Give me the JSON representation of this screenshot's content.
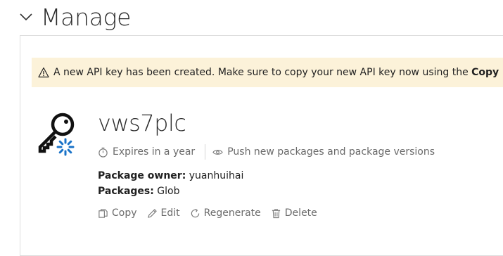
{
  "section": {
    "title": "Manage",
    "chevron_icon": "chevron-down-icon"
  },
  "alert": {
    "icon": "warning-icon",
    "text": "A new API key has been created. Make sure to copy your new API key now using the ",
    "bold_text": "Copy",
    "background": "#fcf2d9"
  },
  "api_key": {
    "icon": "key-icon",
    "name": "vws7plc",
    "expires": "Expires in a year",
    "scope": "Push new packages and package versions",
    "owner_label": "Package owner:",
    "owner_value": "yuanhuihai",
    "packages_label": "Packages:",
    "packages_value": "Glob"
  },
  "actions": {
    "copy": "Copy",
    "edit": "Edit",
    "regenerate": "Regenerate",
    "delete": "Delete"
  },
  "colors": {
    "spinner_accent": "#1a73c8",
    "muted_text": "#6a6a6a"
  }
}
